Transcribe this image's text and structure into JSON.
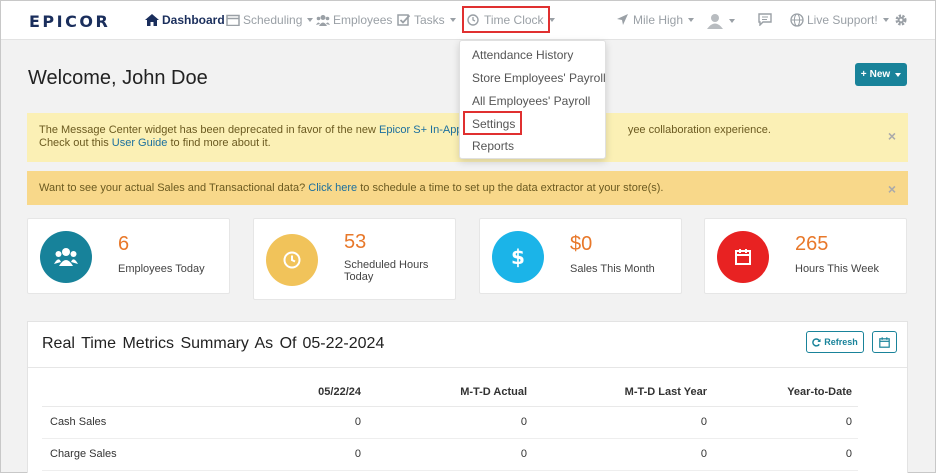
{
  "brand": {
    "logo": "EPICOR"
  },
  "nav": {
    "dashboard": "Dashboard",
    "scheduling": "Scheduling",
    "employees": "Employees",
    "tasks": "Tasks",
    "time_clock": "Time Clock",
    "location": "Mile High",
    "live_support": "Live Support!"
  },
  "time_clock_menu": {
    "items": [
      "Attendance History",
      "Store Employees' Payroll",
      "All Employees' Payroll",
      "Settings",
      "Reports"
    ]
  },
  "page": {
    "welcome": "Welcome, John Doe",
    "new_button": "New"
  },
  "alerts": {
    "message_center": {
      "text_before": "The Message Center widget has been deprecated in favor of the new ",
      "link1": "Epicor S+ In-App Me",
      "text_after": "yee collaboration experience.",
      "line2_before": "Check out this ",
      "link2": "User Guide",
      "line2_after": " to find more about it.",
      "close": "×"
    },
    "sales_data": {
      "text_before": "Want to see your actual Sales and Transactional data? ",
      "link": "Click here",
      "text_after": " to schedule a time to set up the data extractor at your store(s).",
      "close": "×"
    }
  },
  "stats": [
    {
      "value": "6",
      "label": "Employees Today",
      "color": "#17829a",
      "icon": "users-icon"
    },
    {
      "value": "53",
      "label_line1": "Scheduled Hours",
      "label_line2": "Today",
      "color": "#f1c35a",
      "icon": "clock-icon"
    },
    {
      "value": "$0",
      "label": "Sales This Month",
      "color": "#1bb4e8",
      "icon": "dollar-icon"
    },
    {
      "value": "265",
      "label": "Hours This Week",
      "color": "#e82222",
      "icon": "calendar-icon"
    }
  ],
  "metrics": {
    "title": "Real Time Metrics Summary As Of",
    "date": "05-22-2024",
    "refresh": "Refresh",
    "columns": [
      "",
      "05/22/24",
      "M-T-D Actual",
      "M-T-D Last Year",
      "Year-to-Date"
    ],
    "rows": [
      [
        "Cash Sales",
        "0",
        "0",
        "0",
        "0"
      ],
      [
        "Charge Sales",
        "0",
        "0",
        "0",
        "0"
      ]
    ]
  },
  "colors": {
    "accent": "#19839a",
    "orange": "#e8782a",
    "highlight_red": "#e03030"
  }
}
